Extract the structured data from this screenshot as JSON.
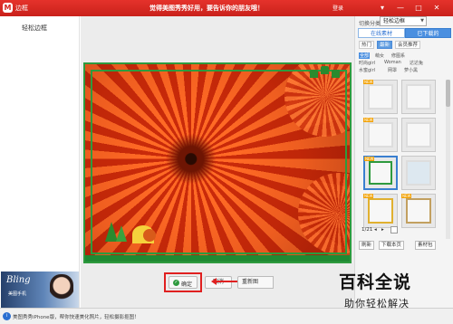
{
  "titlebar": {
    "app_name": "边框",
    "notice": "觉得美图秀秀好用，要告诉你的朋友哦！",
    "login": "登录",
    "controls": [
      "▾",
      "—",
      "□",
      "✕"
    ]
  },
  "left_panel": {
    "title": "轻松边框",
    "promo": {
      "brand": "Bling",
      "subtitle": "美图手机"
    }
  },
  "toolbar": {
    "confirm_label": "确定",
    "cancel_label": "取消",
    "redraw_label": "重新图"
  },
  "right_panel": {
    "category_label": "切换分类",
    "category_value": "轻松边框",
    "tabs": [
      "在线素材",
      "已下载的"
    ],
    "subtabs": [
      "热门",
      "最新",
      "会员推荐"
    ],
    "active_subtab": "最新",
    "filters": [
      "全部",
      "萌女",
      "修图系",
      "时尚girl",
      "Woman",
      "达达兔",
      "水蜜girl",
      "网罩",
      "萝小黑"
    ],
    "active_filter": "全部",
    "thumb_tags": [
      "NEW",
      "",
      "NEW",
      "",
      "NEW",
      "",
      "NEW",
      "NEW"
    ],
    "pager": {
      "current": "1/21"
    },
    "actions": [
      "刷新",
      "下载本页",
      "素材包"
    ]
  },
  "statusbar": {
    "text": "美图秀秀iPhone版，帮你快速美化照片，轻松摄影抠图！"
  },
  "watermark": {
    "main": "百科全说",
    "sub": "助你轻松解决"
  },
  "colors": {
    "brand_red": "#d4251f",
    "frame_green": "#2e9a3e",
    "accent_blue": "#4a8fe0",
    "highlight_red": "#e02020"
  }
}
